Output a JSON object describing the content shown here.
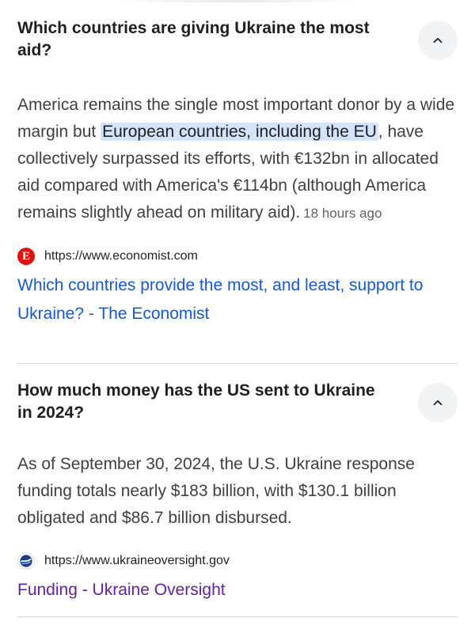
{
  "faq": [
    {
      "question": "Which countries are giving Ukraine the most aid?",
      "answer": {
        "before": "America remains the single most important donor by a wide margin but ",
        "highlight": "European countries, including the EU",
        "after": ", have collectively surpassed its efforts, with €132bn in allocated aid compared with America's €114bn (although America remains slightly ahead on military aid).",
        "timestamp": "18 hours ago"
      },
      "source": {
        "icon": "economist-logo-icon",
        "favicon_letter": "E",
        "url": "https://www.economist.com",
        "title": "Which countries provide the most, and least, support to Ukraine? - The Economist"
      },
      "expanded": true
    },
    {
      "question": "How much money has the US sent to Ukraine in 2024?",
      "answer": {
        "text": "As of September 30, 2024, the U.S. Ukraine response funding totals nearly $183 billion, with $130.1 billion obligated and $86.7 billion disbursed."
      },
      "source": {
        "icon": "ukraine-oversight-logo-icon",
        "url": "https://www.ukraineoversight.gov",
        "title": "Funding - Ukraine Oversight"
      },
      "expanded": true
    }
  ],
  "colors": {
    "link": "#1558d6",
    "visited_link": "#681da8",
    "highlight": "#d3e3fd",
    "toggle_bg": "#f1f3f4",
    "economist_red": "#e3120b"
  }
}
